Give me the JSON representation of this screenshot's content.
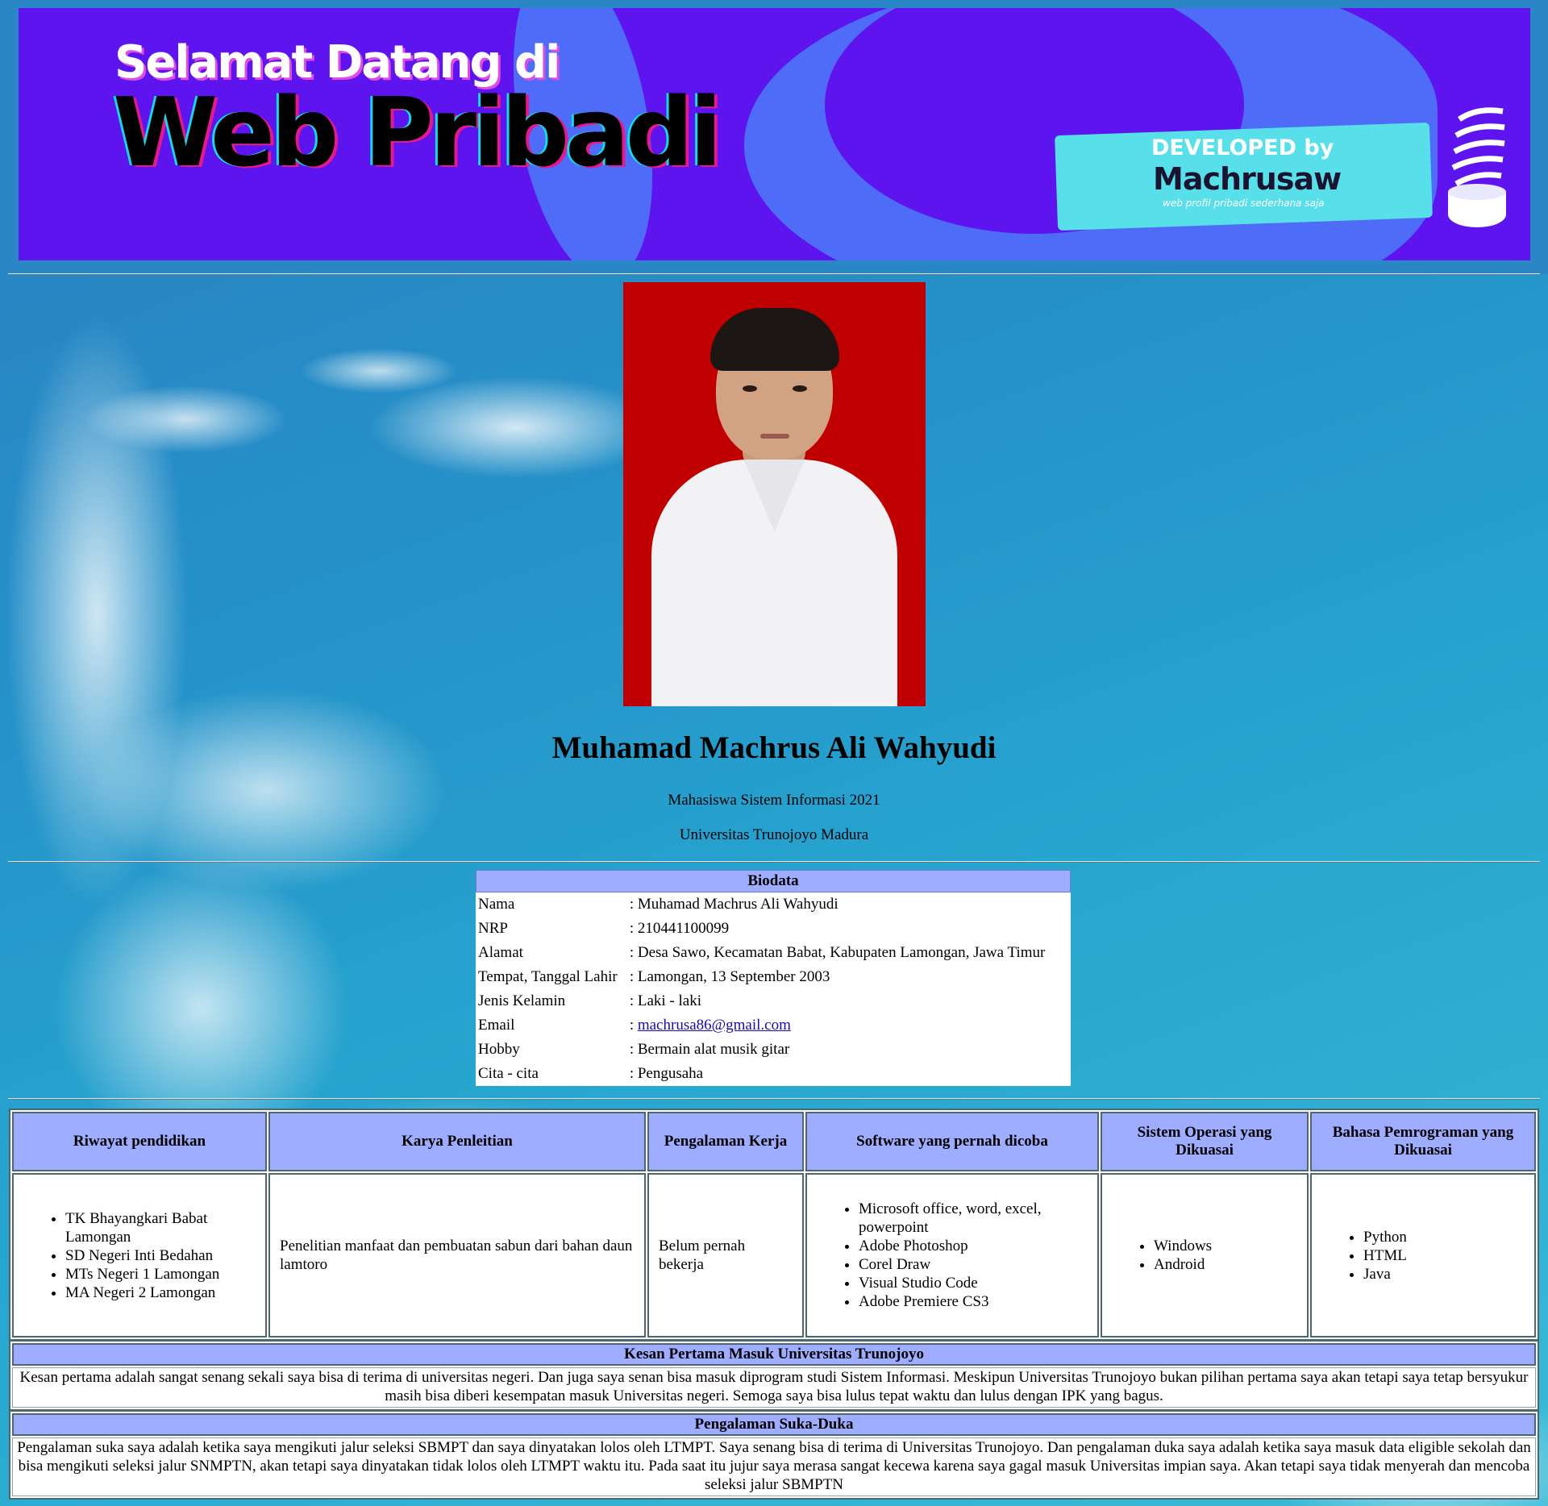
{
  "banner": {
    "line1": "Selamat Datang di",
    "line2": "Web Pribadi",
    "badge_line1": "DEVELOPED by",
    "badge_line2": "Machrusaw",
    "badge_line3": "web profil pribadi sederhana saja"
  },
  "profile": {
    "name": "Muhamad Machrus Ali Wahyudi",
    "subtitle": "Mahasiswa Sistem Informasi 2021",
    "university": "Universitas Trunojoyo Madura"
  },
  "biodata": {
    "title": "Biodata",
    "rows": [
      {
        "label": "Nama",
        "value": ": Muhamad Machrus Ali Wahyudi"
      },
      {
        "label": "NRP",
        "value": ": 210441100099"
      },
      {
        "label": "Alamat",
        "value": ": Desa Sawo, Kecamatan Babat, Kabupaten Lamongan, Jawa Timur"
      },
      {
        "label": "Tempat, Tanggal Lahir",
        "value": ": Lamongan, 13 September 2003"
      },
      {
        "label": "Jenis Kelamin",
        "value": ": Laki - laki"
      },
      {
        "label": "Email",
        "prefix": ": ",
        "value": "machrusa86@gmail.com"
      },
      {
        "label": "Hobby",
        "value": ": Bermain alat musik gitar"
      },
      {
        "label": "Cita - cita",
        "value": ": Pengusaha"
      }
    ]
  },
  "info_table": {
    "headers": [
      "Riwayat pendidikan",
      "Karya Penleitian",
      "Pengalaman Kerja",
      "Software yang pernah dicoba",
      "Sistem Operasi yang Dikuasai",
      "Bahasa Pemrograman yang Dikuasai"
    ],
    "education": [
      "TK Bhayangkari Babat Lamongan",
      "SD Negeri Inti Bedahan",
      "MTs Negeri 1 Lamongan",
      "MA Negeri 2 Lamongan"
    ],
    "research": "Penelitian manfaat dan pembuatan sabun dari bahan daun lamtoro",
    "work": "Belum pernah bekerja",
    "software": [
      "Microsoft office, word, excel, powerpoint",
      "Adobe Photoshop",
      "Corel Draw",
      "Visual Studio Code",
      "Adobe Premiere CS3"
    ],
    "os": [
      "Windows",
      "Android"
    ],
    "languages": [
      "Python",
      "HTML",
      "Java"
    ]
  },
  "kesan": {
    "title": "Kesan Pertama Masuk Universitas Trunojoyo",
    "text": "Kesan pertama adalah sangat senang sekali saya bisa di terima di universitas negeri. Dan juga saya senan bisa masuk diprogram studi Sistem Informasi. Meskipun Universitas Trunojoyo bukan pilihan pertama saya akan tetapi saya tetap bersyukur masih bisa diberi kesempatan masuk Universitas negeri. Semoga saya bisa lulus tepat waktu dan lulus dengan IPK yang bagus."
  },
  "pengalaman": {
    "title": "Pengalaman Suka-Duka",
    "text": "Pengalaman suka saya adalah ketika saya mengikuti jalur seleksi SBMPT dan saya dinyatakan lolos oleh LTMPT. Saya senang bisa di terima di Universitas Trunojoyo. Dan pengalaman duka saya adalah ketika saya masuk data eligible sekolah dan bisa mengikuti seleksi jalur SNMPTN, akan tetapi saya dinyatakan tidak lolos oleh LTMPT waktu itu. Pada saat itu jujur saya merasa sangat kecewa karena saya gagal masuk Universitas impian saya. Akan tetapi saya tidak menyerah dan mencoba seleksi jalur SBMPTN"
  }
}
